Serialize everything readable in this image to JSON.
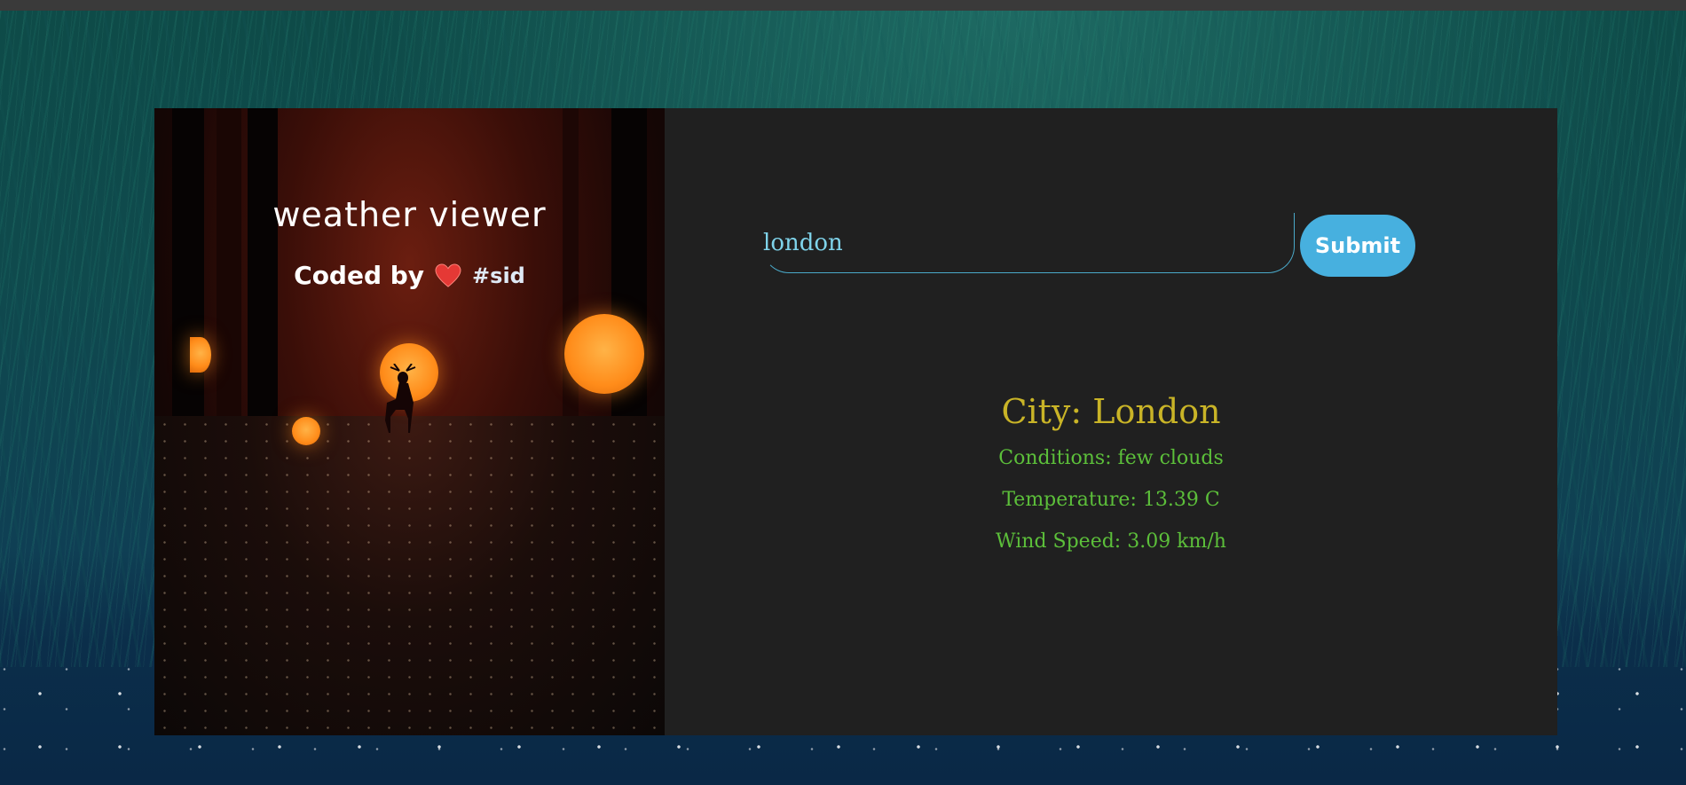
{
  "app": {
    "title": "weather viewer",
    "credit_prefix": "Coded by",
    "author": "#sid"
  },
  "search": {
    "value": "london",
    "submit_label": "Submit"
  },
  "results": {
    "city": "City: London",
    "conditions": "Conditions: few clouds",
    "temperature": "Temperature: 13.39 C",
    "wind": "Wind Speed: 3.09 km/h"
  },
  "colors": {
    "accent": "#47b0df",
    "city_text": "#c9b427",
    "info_text": "#5cbf3a",
    "card_bg": "#202020"
  },
  "icons": [
    "heart-icon",
    "deer-illustration"
  ]
}
